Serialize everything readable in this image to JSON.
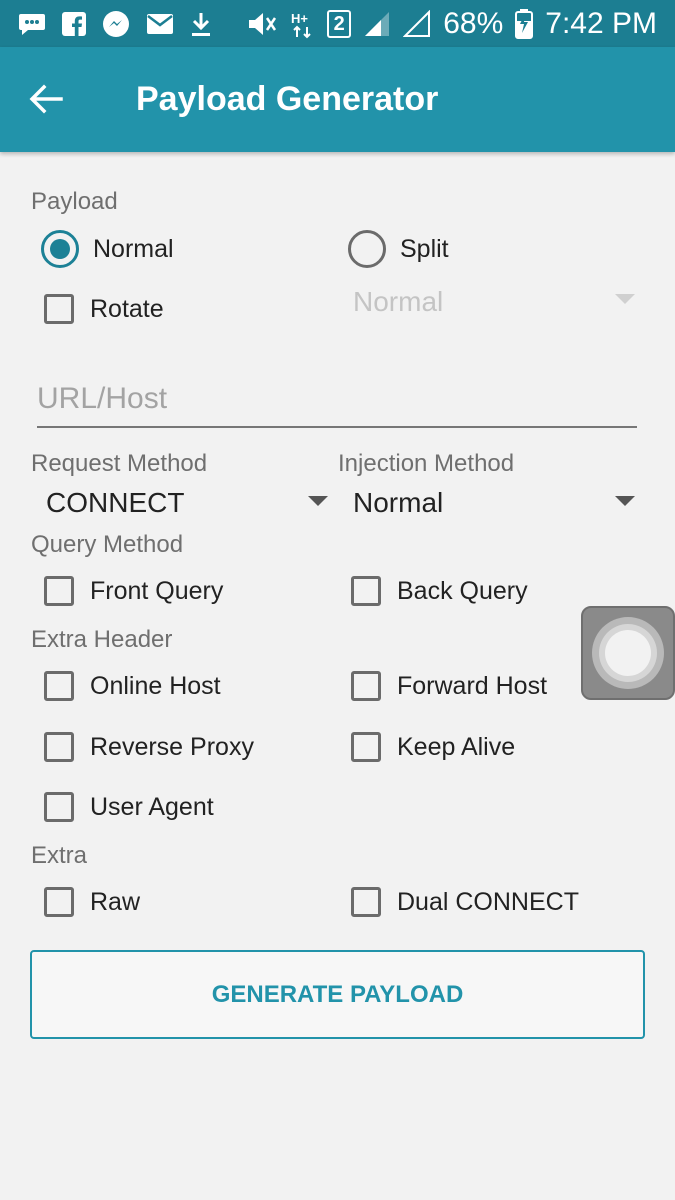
{
  "status_bar": {
    "icons": [
      "messages-icon",
      "facebook-icon",
      "messenger-icon",
      "email-icon",
      "download-icon",
      "mute-icon",
      "hplus-data-icon",
      "sim2-icon",
      "signal-icon",
      "signal-empty-icon",
      "battery-charging-icon"
    ],
    "sim_label": "2",
    "battery": "68%",
    "time": "7:42 PM"
  },
  "app_bar": {
    "title": "Payload Generator",
    "back_icon": "arrow-left-icon"
  },
  "payload": {
    "label": "Payload",
    "normal_label": "Normal",
    "split_label": "Split",
    "rotate_label": "Rotate",
    "split_spinner_value": "Normal",
    "selected": "Normal"
  },
  "url_host": {
    "placeholder": "URL/Host",
    "value": ""
  },
  "request_method": {
    "label": "Request Method",
    "value": "CONNECT"
  },
  "injection_method": {
    "label": "Injection Method",
    "value": "Normal"
  },
  "query_method": {
    "label": "Query Method",
    "front_query": "Front Query",
    "back_query": "Back Query"
  },
  "extra_header": {
    "label": "Extra Header",
    "online_host": "Online Host",
    "forward_host": "Forward Host",
    "reverse_proxy": "Reverse Proxy",
    "keep_alive": "Keep Alive",
    "user_agent": "User Agent"
  },
  "extra": {
    "label": "Extra",
    "raw": "Raw",
    "dual_connect": "Dual CONNECT"
  },
  "generate_button": "GENERATE PAYLOAD",
  "colors": {
    "status_bar": "#1c7e92",
    "app_bar": "#2293aa",
    "accent": "#1c8196",
    "background": "#f2f2f2"
  }
}
